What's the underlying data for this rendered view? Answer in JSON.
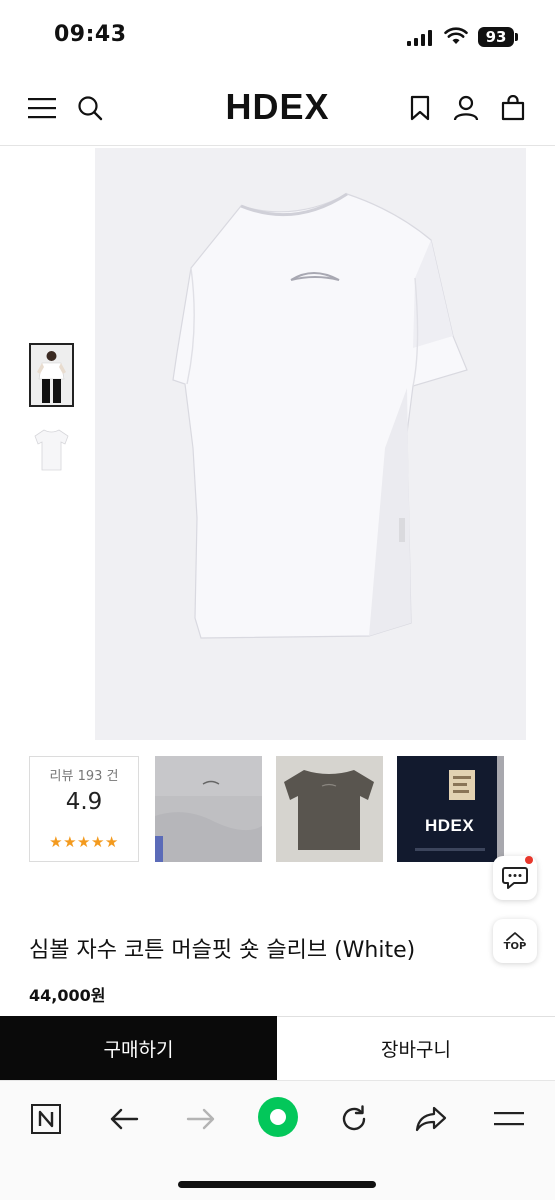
{
  "status_bar": {
    "time": "09:43",
    "battery": "93"
  },
  "header": {
    "brand": "HDEX"
  },
  "icons": {
    "menu": "hamburger-menu-icon",
    "search": "search-icon",
    "bookmark": "bookmark-icon",
    "account": "user-icon",
    "bag": "shopping-bag-icon"
  },
  "review": {
    "count_label": "리뷰 193 건",
    "score": "4.9",
    "stars": "★★★★★"
  },
  "review_photos": [
    {
      "caption": ""
    },
    {
      "caption": ""
    },
    {
      "caption": "HDEX"
    }
  ],
  "floating": {
    "top_label": "TOP"
  },
  "product": {
    "title": "심볼 자수 코튼 머슬핏 숏 슬리브 (White)",
    "price": "44,000원"
  },
  "actions": {
    "buy_label": "구매하기",
    "cart_label": "장바구니"
  },
  "colors": {
    "primary": "#0a0a0a",
    "star": "#f39a1e",
    "refresh_accent": "#03c75a",
    "notification": "#e8372c"
  }
}
